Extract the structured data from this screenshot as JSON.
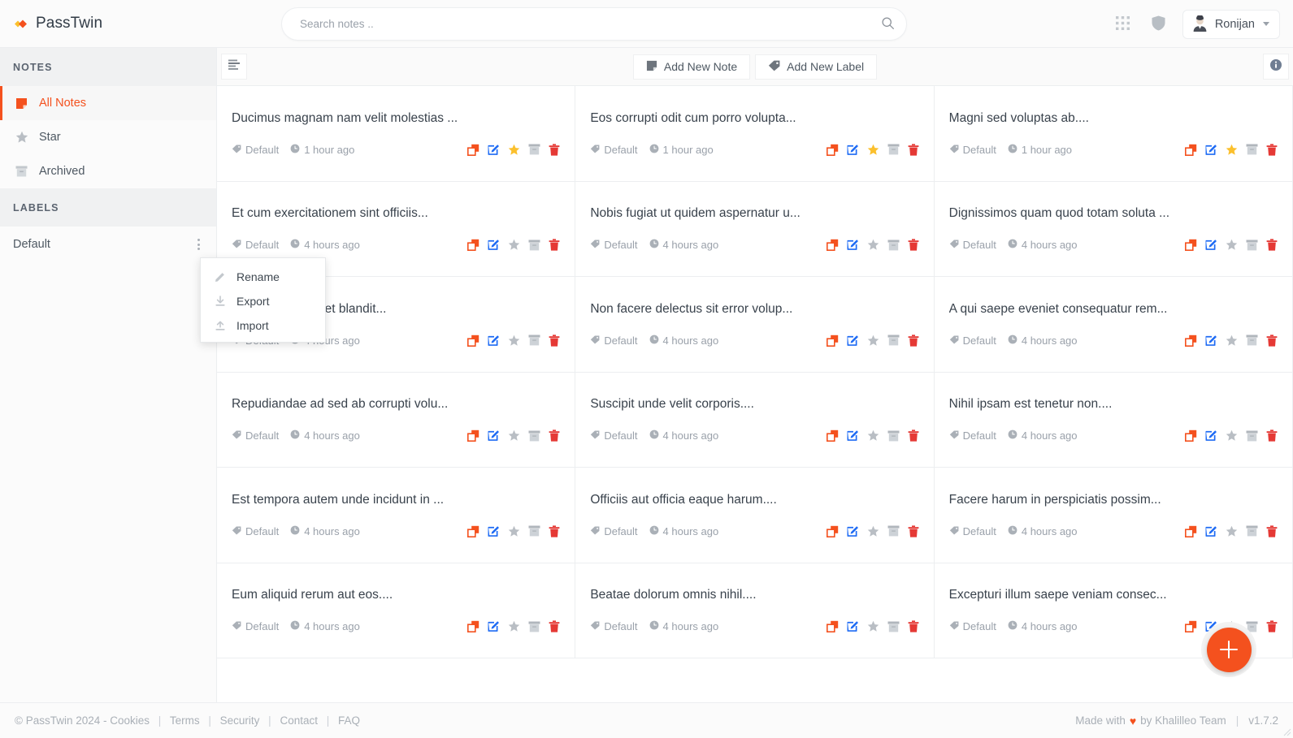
{
  "app": {
    "brand": "PassTwin",
    "brand_color": "#f4511e",
    "accent_color": "#f4511e"
  },
  "topbar": {
    "search": {
      "placeholder": "Search notes ..",
      "value": "",
      "icon": "search-icon"
    },
    "apps_icon": "grid-apps-icon",
    "shield_icon": "shield-icon",
    "user": {
      "name": "Ronijan",
      "avatar": "user-avatar",
      "caret": "chevron-down-icon"
    }
  },
  "sidebar": {
    "sections": [
      {
        "title": "NOTES",
        "items": [
          {
            "label": "All Notes",
            "icon": "note-icon",
            "active": true
          },
          {
            "label": "Star",
            "icon": "star-icon",
            "active": false
          },
          {
            "label": "Archived",
            "icon": "archive-icon",
            "active": false
          }
        ]
      },
      {
        "title": "LABELS",
        "items": [
          {
            "label": "Default",
            "icon": "",
            "active": false,
            "kebab": "more-vertical-icon"
          }
        ]
      }
    ]
  },
  "context_menu": {
    "visible": true,
    "items": [
      {
        "label": "Rename",
        "icon": "pencil-icon"
      },
      {
        "label": "Export",
        "icon": "download-icon"
      },
      {
        "label": "Import",
        "icon": "upload-icon"
      }
    ]
  },
  "toolbar": {
    "list_view_icon": "list-align-icon",
    "add_note_label": "Add New Note",
    "add_note_icon": "note-icon",
    "add_label_label": "Add New Label",
    "add_label_icon": "tag-icon",
    "info_icon": "info-icon"
  },
  "note_actions": {
    "copy": {
      "name": "copy-icon",
      "color": "#f4511e"
    },
    "edit": {
      "name": "edit-icon",
      "color": "#1e6bf4"
    },
    "star": {
      "name": "star-icon",
      "color_on": "#fbc02d",
      "color_off": "#b9bec4"
    },
    "archive": {
      "name": "archive-icon",
      "color": "#b0b6bc"
    },
    "delete": {
      "name": "trash-icon",
      "color": "#e53935"
    }
  },
  "notes": [
    {
      "title": "Ducimus magnam nam velit molestias ...",
      "label": "Default",
      "time": "1 hour ago",
      "starred": true
    },
    {
      "title": "Eos corrupti odit cum porro volupta...",
      "label": "Default",
      "time": "1 hour ago",
      "starred": true
    },
    {
      "title": "Magni sed voluptas ab....",
      "label": "Default",
      "time": "1 hour ago",
      "starred": true
    },
    {
      "title": "Et cum exercitationem sint officiis...",
      "label": "Default",
      "time": "4 hours ago",
      "starred": false
    },
    {
      "title": "Nobis fugiat ut quidem aspernatur u...",
      "label": "Default",
      "time": "4 hours ago",
      "starred": false
    },
    {
      "title": "Dignissimos quam quod totam soluta ...",
      "label": "Default",
      "time": "4 hours ago",
      "starred": false
    },
    {
      "title": "Voluptatibus aut et blandit...",
      "label": "Default",
      "time": "4 hours ago",
      "starred": false
    },
    {
      "title": "Non facere delectus sit error volup...",
      "label": "Default",
      "time": "4 hours ago",
      "starred": false
    },
    {
      "title": "A qui saepe eveniet consequatur rem...",
      "label": "Default",
      "time": "4 hours ago",
      "starred": false
    },
    {
      "title": "Repudiandae ad sed ab corrupti volu...",
      "label": "Default",
      "time": "4 hours ago",
      "starred": false
    },
    {
      "title": "Suscipit unde velit corporis....",
      "label": "Default",
      "time": "4 hours ago",
      "starred": false
    },
    {
      "title": "Nihil ipsam est tenetur non....",
      "label": "Default",
      "time": "4 hours ago",
      "starred": false
    },
    {
      "title": "Est tempora autem unde incidunt in ...",
      "label": "Default",
      "time": "4 hours ago",
      "starred": false
    },
    {
      "title": "Officiis aut officia eaque harum....",
      "label": "Default",
      "time": "4 hours ago",
      "starred": false
    },
    {
      "title": "Facere harum in perspiciatis possim...",
      "label": "Default",
      "time": "4 hours ago",
      "starred": false
    },
    {
      "title": "Eum aliquid rerum aut eos....",
      "label": "Default",
      "time": "4 hours ago",
      "starred": false
    },
    {
      "title": "Beatae dolorum omnis nihil....",
      "label": "Default",
      "time": "4 hours ago",
      "starred": false
    },
    {
      "title": "Excepturi illum saepe veniam consec...",
      "label": "Default",
      "time": "4 hours ago",
      "starred": false
    }
  ],
  "fab": {
    "icon": "plus-icon",
    "label": ""
  },
  "footer": {
    "copyright": "© PassTwin 2024 - Cookies",
    "links": [
      "Terms",
      "Security",
      "Contact",
      "FAQ"
    ],
    "made_with_prefix": "Made with",
    "heart": "♥",
    "made_with_suffix": "by Khalilleo Team",
    "version": "v1.7.2"
  }
}
